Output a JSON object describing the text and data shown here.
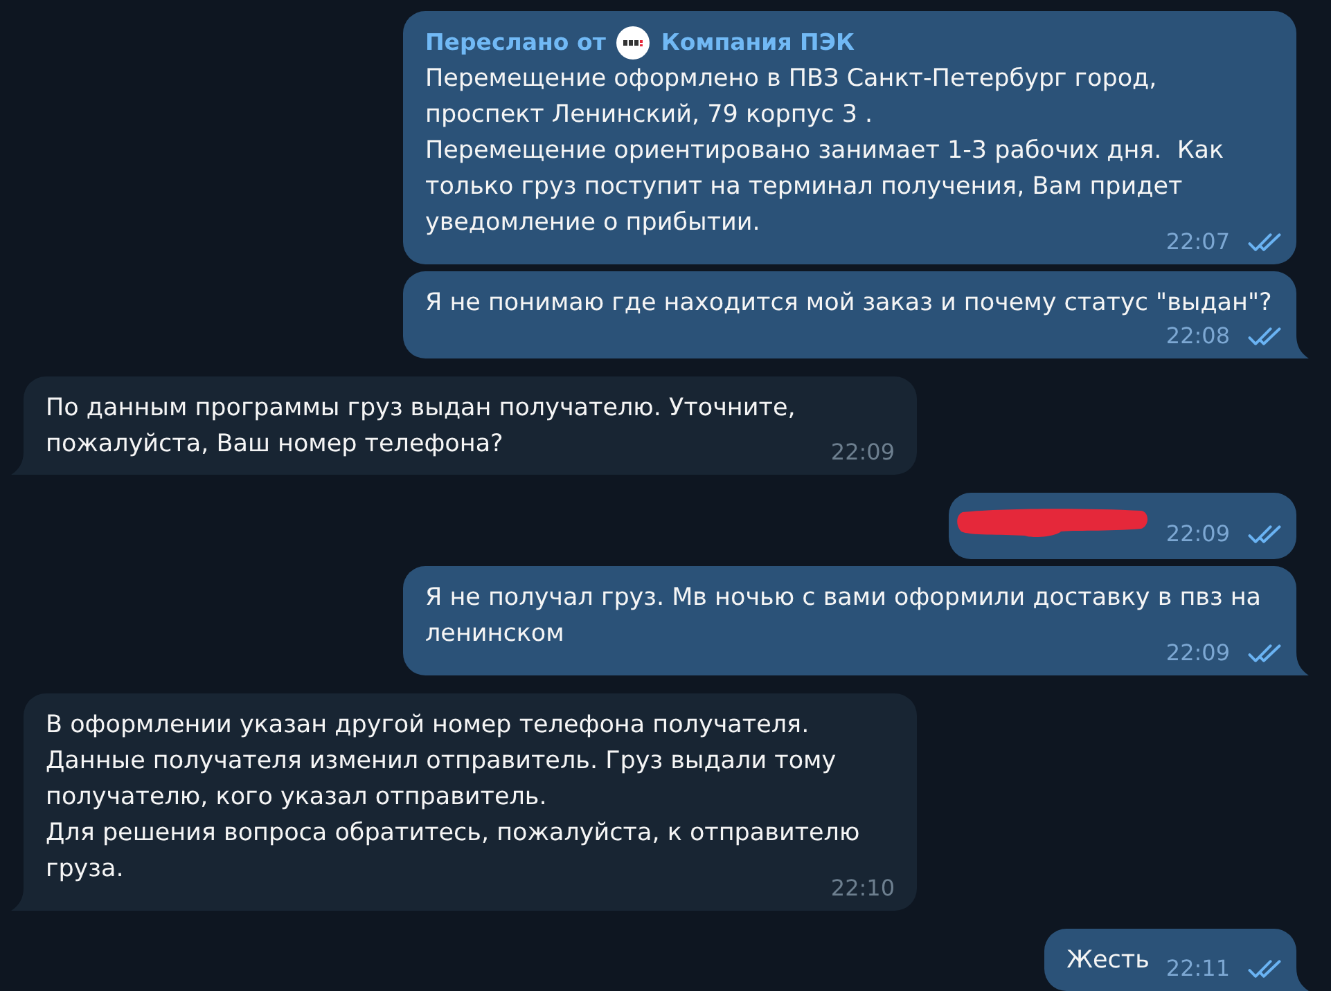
{
  "messages": [
    {
      "kind": "forwarded",
      "outgoing": true,
      "forwarded_label": "Переслано от",
      "source": "Компания ПЭК",
      "text": "Перемещение оформлено в ПВЗ Санкт-Петербург город,\nпроспект Ленинский, 79 корпус 3 .\nПеремещение ориентировано занимает 1-3 рабочих дня.  Как\nтолько груз поступит на терминал получения, Вам придет\nуведомление о прибытии.",
      "time": "22:07",
      "read": true,
      "tail": false
    },
    {
      "kind": "text",
      "outgoing": true,
      "text": "Я не понимаю где находится мой заказ и почему статус \"выдан\"?",
      "time": "22:08",
      "read": true,
      "tail": true
    },
    {
      "kind": "text",
      "outgoing": false,
      "text": "По данным программы груз выдан получателю. Уточните,\nпожалуйста, Ваш номер телефона?",
      "time": "22:09",
      "tail": true
    },
    {
      "kind": "redacted",
      "outgoing": true,
      "time": "22:09",
      "read": true,
      "tail": false
    },
    {
      "kind": "text",
      "outgoing": true,
      "text": "Я не получал груз. Мв ночью с вами оформили доставку в пвз на\nленинском",
      "time": "22:09",
      "read": true,
      "tail": true
    },
    {
      "kind": "text",
      "outgoing": false,
      "text": "В оформлении указан другой номер телефона получателя.\nДанные получателя изменил отправитель. Груз выдали тому\nполучателю, кого указал отправитель.\nДля решения вопроса обратитесь, пожалуйста, к отправителю\nгруза.",
      "time": "22:10",
      "tail": true
    },
    {
      "kind": "text",
      "outgoing": true,
      "text": "Жесть",
      "time": "22:11",
      "read": true,
      "tail": true
    }
  ]
}
